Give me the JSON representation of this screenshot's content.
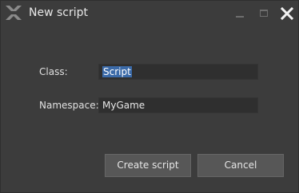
{
  "window": {
    "title": "New script",
    "icon": "flax-logo-icon",
    "controls": [
      "minimize-icon",
      "maximize-icon",
      "close-icon"
    ]
  },
  "form": {
    "class_label": "Class:",
    "class_value": "Script",
    "namespace_label": "Namespace:",
    "namespace_value": "MyGame"
  },
  "buttons": {
    "create_label": "Create script",
    "cancel_label": "Cancel"
  },
  "colors": {
    "background": "#3c3c3c",
    "input_background": "#2f2f2f",
    "button_background": "#575757",
    "selection": "#3b6aa8"
  }
}
